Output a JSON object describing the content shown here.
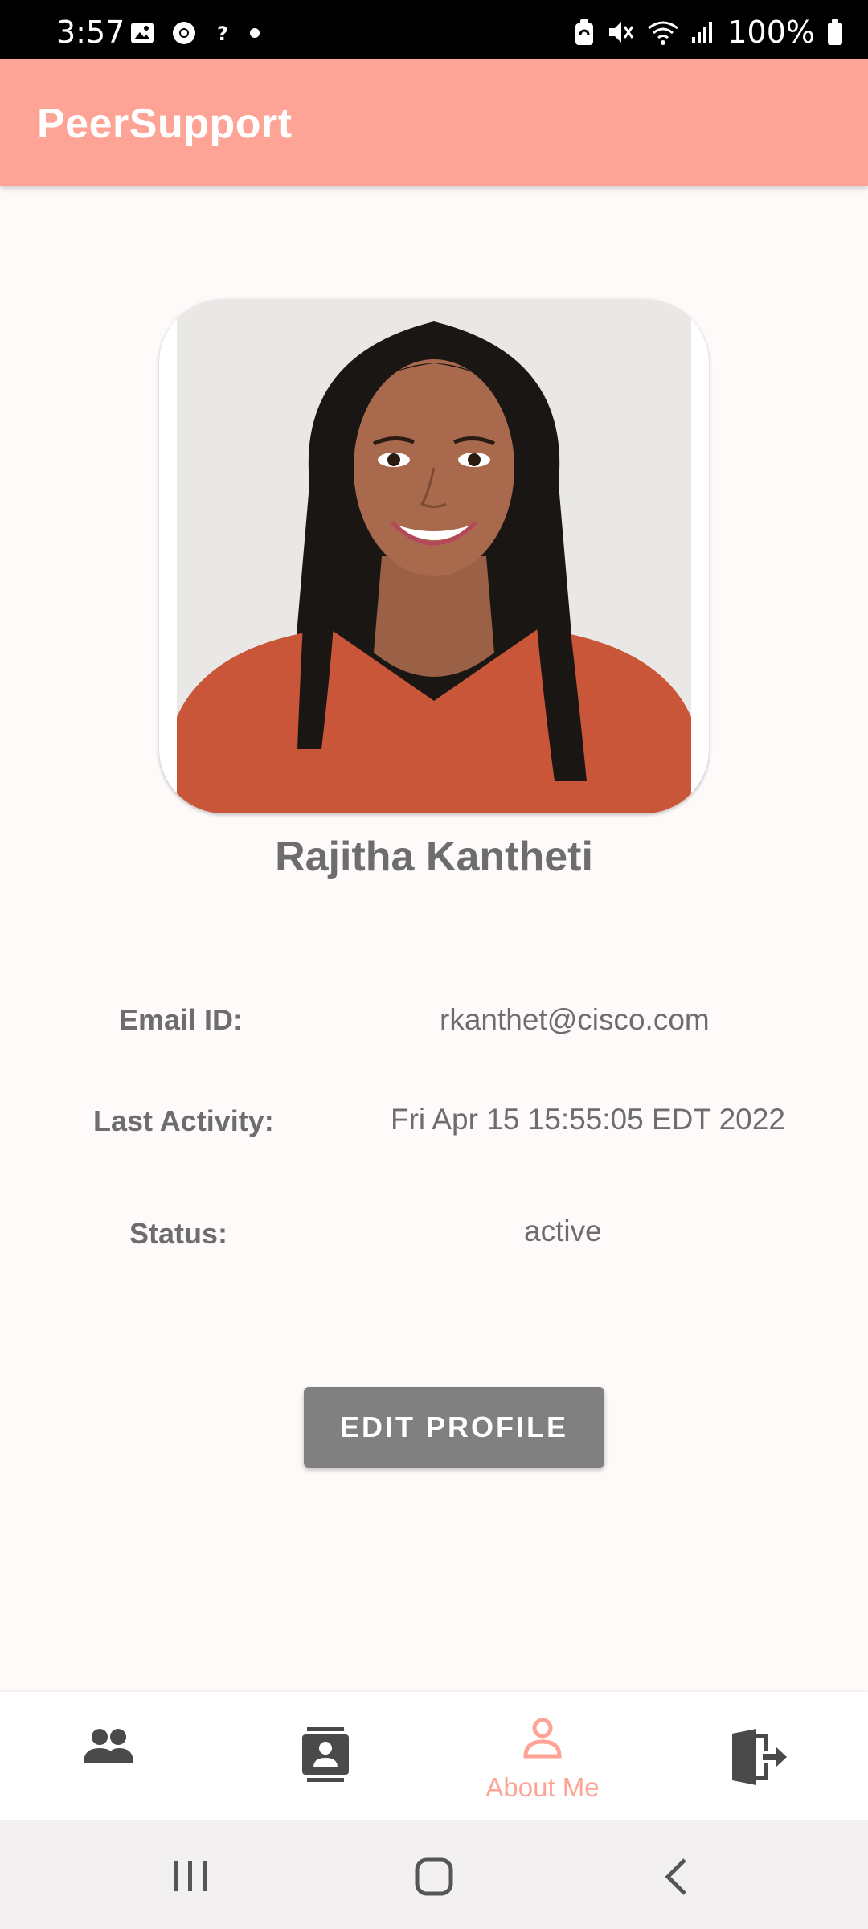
{
  "status_bar": {
    "time": "3:57",
    "left_icons": [
      "gallery-icon",
      "chrome-icon",
      "question-icon",
      "dot-icon"
    ],
    "right_icons": [
      "battery-saver-icon",
      "mute-icon",
      "wifi-icon",
      "signal-icon"
    ],
    "battery_text": "100%"
  },
  "app_bar": {
    "title": "PeerSupport"
  },
  "profile": {
    "name": "Rajitha Kantheti",
    "email_label": "Email ID:",
    "email_value": "rkanthet@cisco.com",
    "activity_label": "Last Activity:",
    "activity_value": "Fri Apr 15 15:55:05 EDT 2022",
    "status_label": "Status:",
    "status_value": "active"
  },
  "edit_button": {
    "label": "EDIT PROFILE"
  },
  "bottom_nav": {
    "items": [
      {
        "icon": "people-icon",
        "label": ""
      },
      {
        "icon": "contact-card-icon",
        "label": ""
      },
      {
        "icon": "person-icon",
        "label": "About Me",
        "selected": true
      },
      {
        "icon": "logout-icon",
        "label": ""
      }
    ]
  },
  "colors": {
    "accent": "#fea496",
    "text_gray": "#6d6d6d",
    "button_gray": "#808080"
  }
}
